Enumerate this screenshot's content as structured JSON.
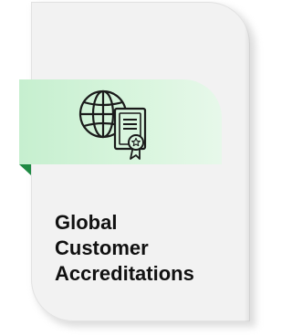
{
  "tile": {
    "title_lines": [
      "Global",
      "Customer",
      "Accreditations"
    ],
    "icon": "globe-certificate-icon",
    "colors": {
      "card": "#f2f2f2",
      "ribbon": "#d6f4db",
      "ribbon_fold": "#1f8a43",
      "text": "#111111"
    }
  }
}
